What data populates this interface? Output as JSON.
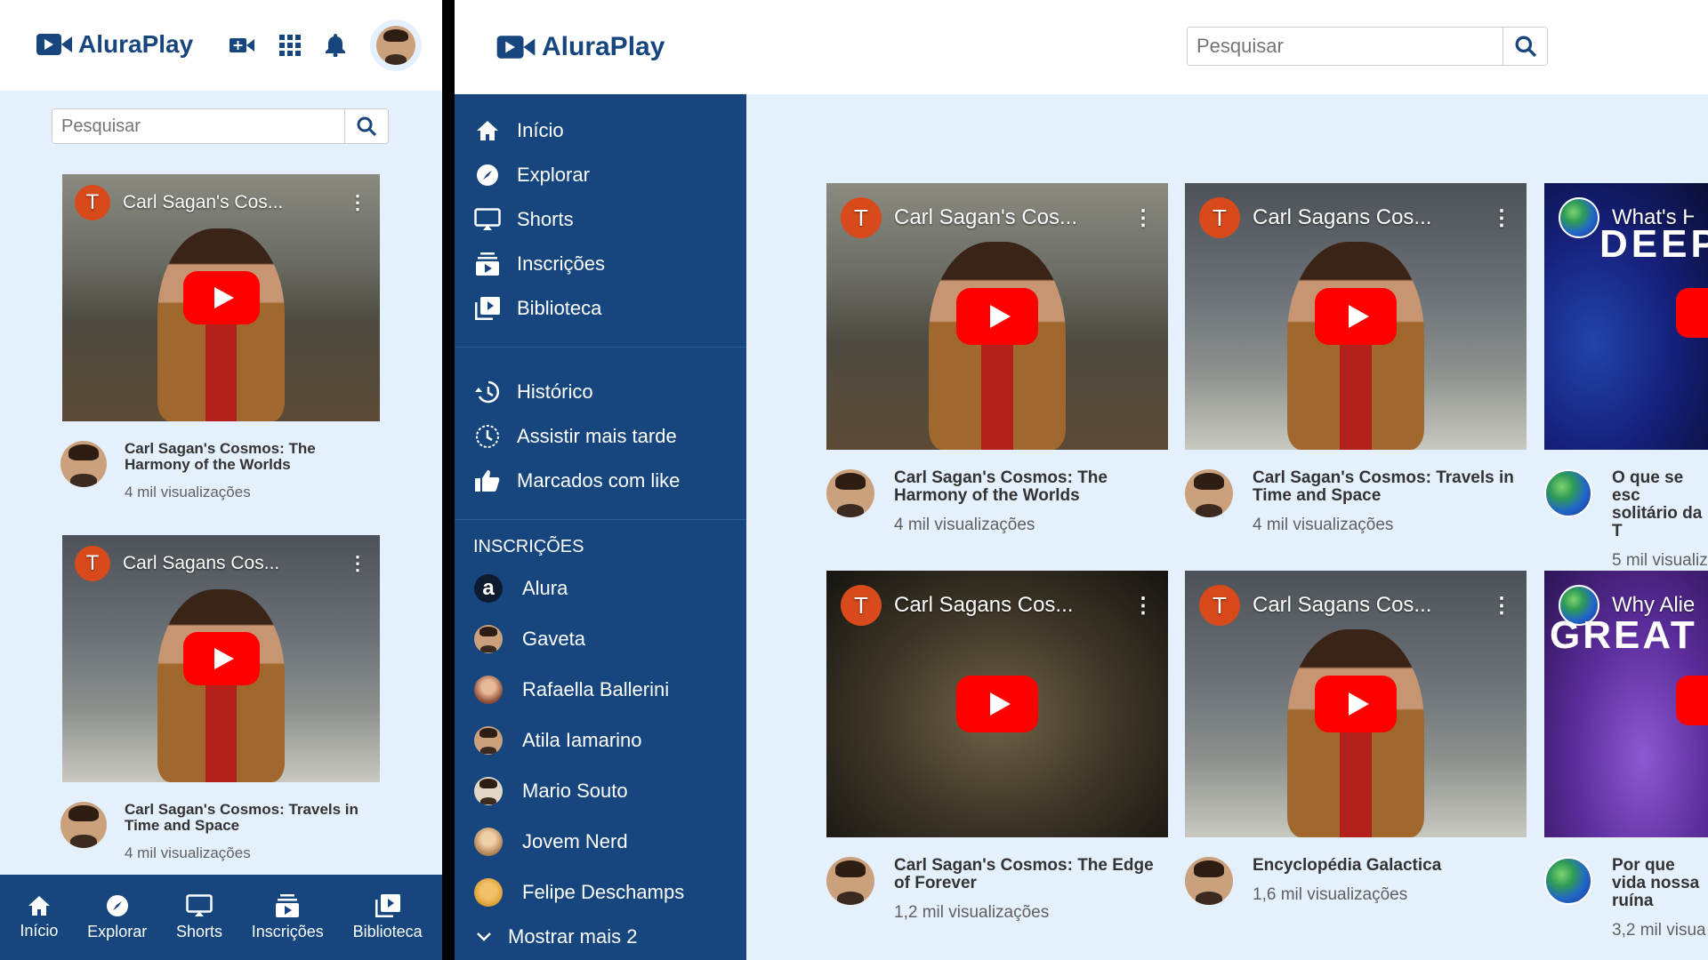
{
  "brand": {
    "name": "AluraPlay"
  },
  "search": {
    "placeholder": "Pesquisar"
  },
  "colors": {
    "primary": "#17467f",
    "background": "#e5f0fd",
    "youtube_red": "#ff0000",
    "channel_avatar": "#d84a1c"
  },
  "mobile": {
    "header_icons": [
      "video-camera-icon",
      "apps-grid-icon",
      "bell-icon",
      "user-avatar"
    ],
    "videos": [
      {
        "overlay_title": "Carl Sagan's Cos...",
        "title": "Carl Sagan's Cosmos: The Harmony of the Worlds",
        "views": "4 mil visualizações",
        "channel_initial": "T"
      },
      {
        "overlay_title": "Carl Sagans Cos...",
        "title": "Carl Sagan's Cosmos: Travels in Time and Space",
        "views": "4 mil visualizações",
        "channel_initial": "T"
      }
    ],
    "bottom_nav": [
      {
        "label": "Início",
        "icon": "home-icon"
      },
      {
        "label": "Explorar",
        "icon": "compass-icon"
      },
      {
        "label": "Shorts",
        "icon": "shorts-icon"
      },
      {
        "label": "Inscrições",
        "icon": "subscriptions-icon"
      },
      {
        "label": "Biblioteca",
        "icon": "library-icon"
      }
    ]
  },
  "desktop": {
    "menu_main": [
      {
        "label": "Início",
        "icon": "home-icon"
      },
      {
        "label": "Explorar",
        "icon": "compass-icon"
      },
      {
        "label": "Shorts",
        "icon": "shorts-icon"
      },
      {
        "label": "Inscrições",
        "icon": "subscriptions-icon"
      },
      {
        "label": "Biblioteca",
        "icon": "library-icon"
      }
    ],
    "menu_secondary": [
      {
        "label": "Histórico",
        "icon": "history-icon"
      },
      {
        "label": "Assistir mais tarde",
        "icon": "clock-icon"
      },
      {
        "label": "Marcados com like",
        "icon": "thumbs-up-icon"
      }
    ],
    "subscriptions_heading": "INSCRIÇÕES",
    "subscriptions": [
      "Alura",
      "Gaveta",
      "Rafaella Ballerini",
      "Atila Iamarino",
      "Mario Souto",
      "Jovem Nerd",
      "Felipe Deschamps"
    ],
    "show_more": "Mostrar mais 2",
    "videos": [
      {
        "overlay_title": "Carl Sagan's Cos...",
        "title": "Carl Sagan's Cosmos: The Harmony of the Worlds",
        "views": "4 mil visualizações",
        "channel_initial": "T"
      },
      {
        "overlay_title": "Carl Sagans Cos...",
        "title": "Carl Sagan's Cosmos: Travels in Time and Space",
        "views": "4 mil visualizações",
        "channel_initial": "T"
      },
      {
        "overlay_title": "What's H",
        "thumb_text": "DEEP",
        "title": "O que se esc solitário da T",
        "views": "5 mil visualiz"
      },
      {
        "overlay_title": "Carl Sagans Cos...",
        "title": "Carl Sagan's Cosmos: The Edge of Forever",
        "views": "1,2 mil visualizações",
        "channel_initial": "T"
      },
      {
        "overlay_title": "Carl Sagans Cos...",
        "title": "Encyclopédia Galactica",
        "views": "1,6 mil visualizações",
        "channel_initial": "T"
      },
      {
        "overlay_title": "Why Alie",
        "thumb_text": "GREAT",
        "title": "Por que vida nossa ruína",
        "views": "3,2 mil visua"
      }
    ]
  }
}
